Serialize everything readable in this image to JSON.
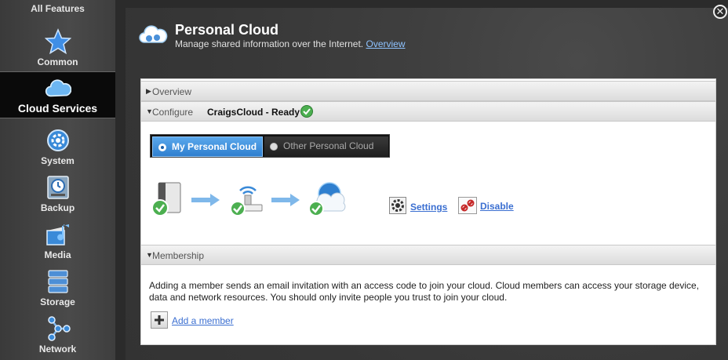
{
  "sidebar": {
    "header": "All Features",
    "items": [
      {
        "label": "Common",
        "icon": "star-icon"
      },
      {
        "label": "Cloud Services",
        "icon": "cloud-icon",
        "active": true
      },
      {
        "label": "System",
        "icon": "gear-icon"
      },
      {
        "label": "Backup",
        "icon": "backup-clock-icon"
      },
      {
        "label": "Media",
        "icon": "media-icon"
      },
      {
        "label": "Storage",
        "icon": "storage-drives-icon"
      },
      {
        "label": "Network",
        "icon": "network-nodes-icon"
      }
    ]
  },
  "header": {
    "title": "Personal Cloud",
    "subtitle": "Manage shared information over the Internet.",
    "overview_link": "Overview"
  },
  "sections": {
    "overview": "Overview",
    "configure": "Configure",
    "cloud_status": "CraigsCloud - Ready",
    "membership": "Membership"
  },
  "toggle": {
    "selected": "My Personal Cloud",
    "unselected": "Other Personal Cloud"
  },
  "actions": {
    "settings": "Settings",
    "disable": "Disable",
    "add_member": "Add a member"
  },
  "membership_text": "Adding a member sends an email invitation with an access code to join your cloud. Cloud members can access your storage device, data and network resources. You should only invite people you trust to join your cloud.",
  "colors": {
    "accent": "#2f7fcf",
    "link": "#3b6fd1",
    "ready": "#4caf50"
  }
}
